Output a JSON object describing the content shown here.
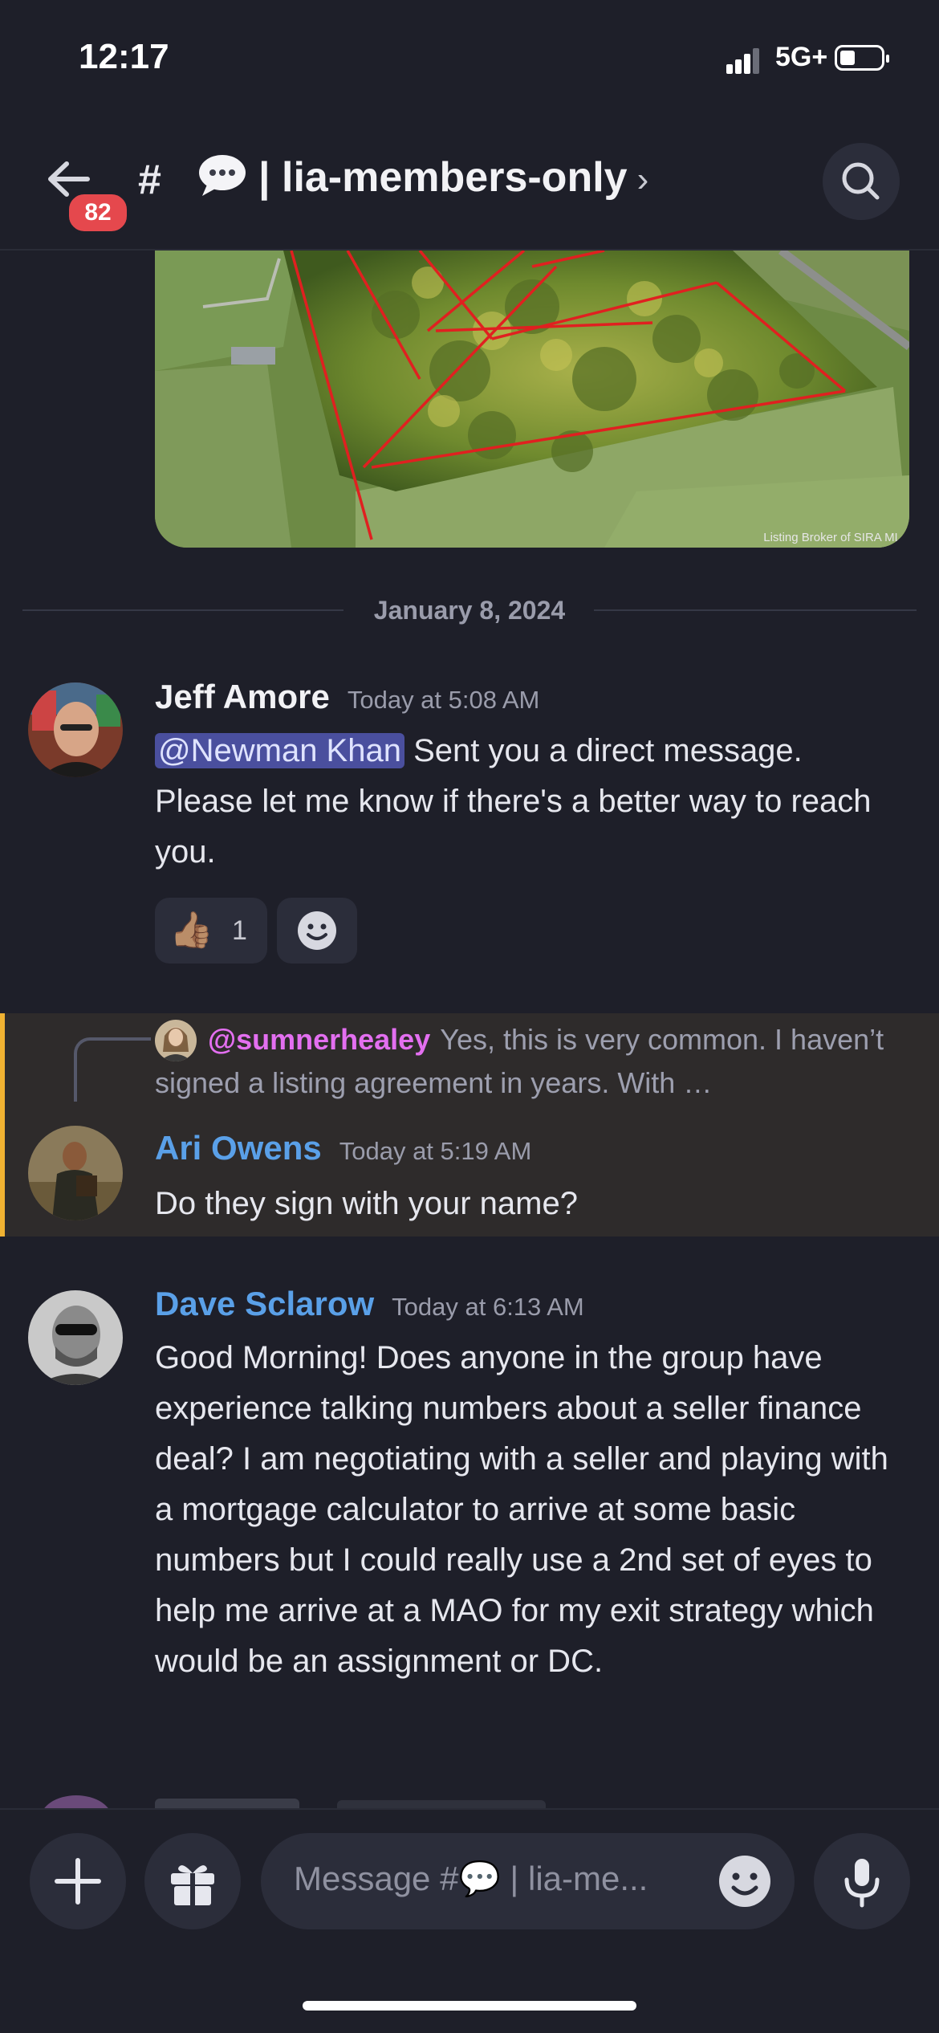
{
  "status_bar": {
    "time": "12:17",
    "network": "5G+"
  },
  "header": {
    "back_badge": "82",
    "channel_prefix": "#",
    "channel_name": "| lia-members-only",
    "chevron": "›"
  },
  "image_caption": "Listing Broker of SIRA ML",
  "date_divider": "January 8, 2024",
  "messages": [
    {
      "author": "Jeff Amore",
      "timestamp": "Today at 5:08 AM",
      "mention": "@Newman Khan",
      "text": " Sent you a direct message. Please let me know if there's a better way to reach you.",
      "author_color": "#f2f2f5",
      "reactions": [
        {
          "emoji": "👍🏽",
          "count": "1"
        }
      ]
    },
    {
      "author": "Ari Owens",
      "timestamp": "Today at 5:19 AM",
      "text": "Do they sign with your name?",
      "author_color": "#5aa0e8",
      "reply": {
        "user": "@sumnerhealey",
        "text": "Yes, this is very common. I haven’t signed a listing agreement in years.   With …"
      }
    },
    {
      "author": "Dave Sclarow",
      "timestamp": "Today at 6:13 AM",
      "text": "Good Morning! Does anyone in the group have experience talking numbers about a seller finance deal? I am negotiating with a seller and playing with a mortgage calculator to arrive at some basic numbers but I could really use a 2nd set of eyes to help me arrive at a MAO for my exit strategy which would be an assignment or DC.",
      "author_color": "#5aa0e8"
    }
  ],
  "composer": {
    "placeholder": "Message #💬 | lia-me..."
  },
  "icons": {
    "back": "arrow-left-icon",
    "search": "search-icon",
    "add": "plus-icon",
    "gift": "gift-icon",
    "emoji": "emoji-icon",
    "mic": "microphone-icon",
    "speech": "speech-bubble-icon"
  }
}
